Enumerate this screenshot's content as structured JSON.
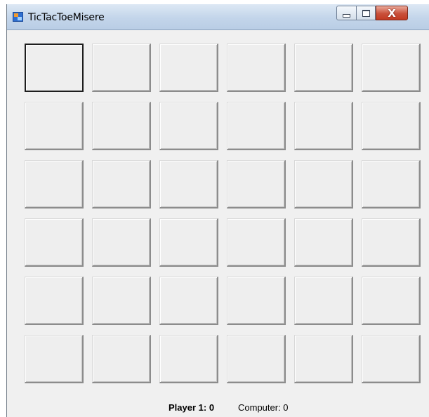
{
  "window": {
    "title": "TicTacToeMisere",
    "icon": "application-icon",
    "controls": {
      "minimize_icon": "minimize-icon",
      "maximize_icon": "maximize-icon",
      "close_label": "X"
    }
  },
  "board": {
    "rows": 6,
    "cols": 6,
    "cells": [
      [
        "",
        "",
        "",
        "",
        "",
        ""
      ],
      [
        "",
        "",
        "",
        "",
        "",
        ""
      ],
      [
        "",
        "",
        "",
        "",
        "",
        ""
      ],
      [
        "",
        "",
        "",
        "",
        "",
        ""
      ],
      [
        "",
        "",
        "",
        "",
        "",
        ""
      ],
      [
        "",
        "",
        "",
        "",
        "",
        ""
      ]
    ],
    "focused_cell": [
      0,
      0
    ]
  },
  "status": {
    "player_score": "Player 1: 0",
    "computer_score": "Computer: 0"
  },
  "colors": {
    "close_button": "#c9503a",
    "titlebar": "#c3d5ea",
    "form_background": "#f0f0f0"
  }
}
